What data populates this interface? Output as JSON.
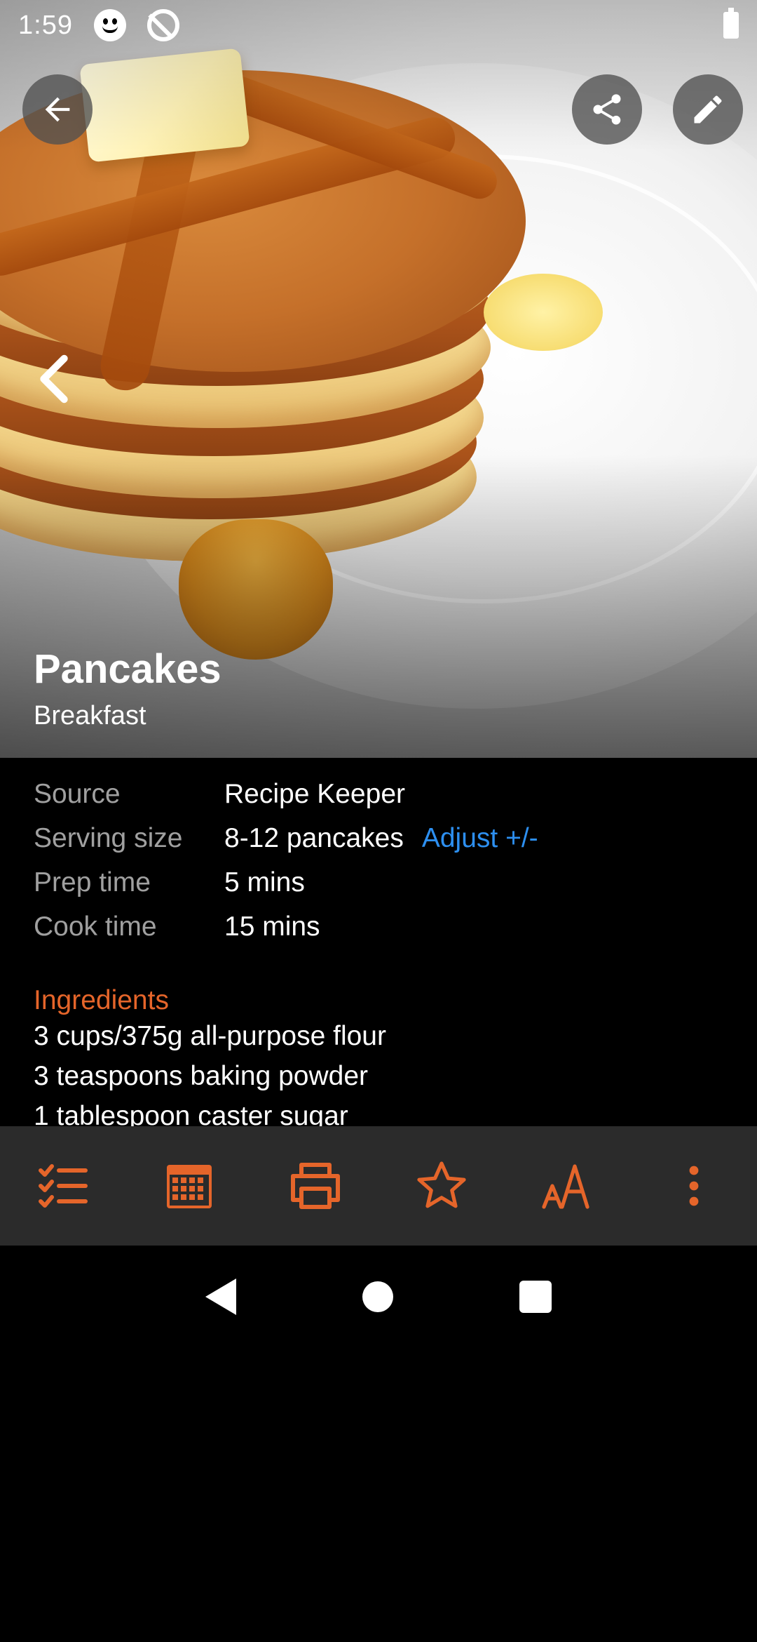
{
  "status_bar": {
    "time": "1:59"
  },
  "recipe": {
    "title": "Pancakes",
    "category": "Breakfast",
    "info": [
      {
        "label": "Source",
        "value": "Recipe Keeper"
      },
      {
        "label": "Serving size",
        "value": "8-12 pancakes",
        "action": "Adjust +/-"
      },
      {
        "label": "Prep time",
        "value": "5 mins"
      },
      {
        "label": "Cook time",
        "value": "15 mins"
      }
    ],
    "ingredients_heading": "Ingredients",
    "ingredients": [
      "3 cups/375g all-purpose flour",
      "3 teaspoons baking powder",
      "1 tablespoon caster sugar"
    ]
  },
  "header_buttons": {
    "back": "arrow-back-icon",
    "share": "share-icon",
    "edit": "pencil-icon",
    "prev_photo": "chevron-left-icon"
  },
  "toolbar": [
    {
      "icon": "checklist-icon"
    },
    {
      "icon": "calendar-icon"
    },
    {
      "icon": "printer-icon"
    },
    {
      "icon": "star-icon"
    },
    {
      "icon": "text-size-icon"
    },
    {
      "icon": "more-vert-icon"
    }
  ],
  "colors": {
    "accent": "#e5652a",
    "link": "#2d8ff0",
    "label": "#a0a0a0",
    "toolbar_bg": "#2b2b2b",
    "background": "#000000"
  }
}
